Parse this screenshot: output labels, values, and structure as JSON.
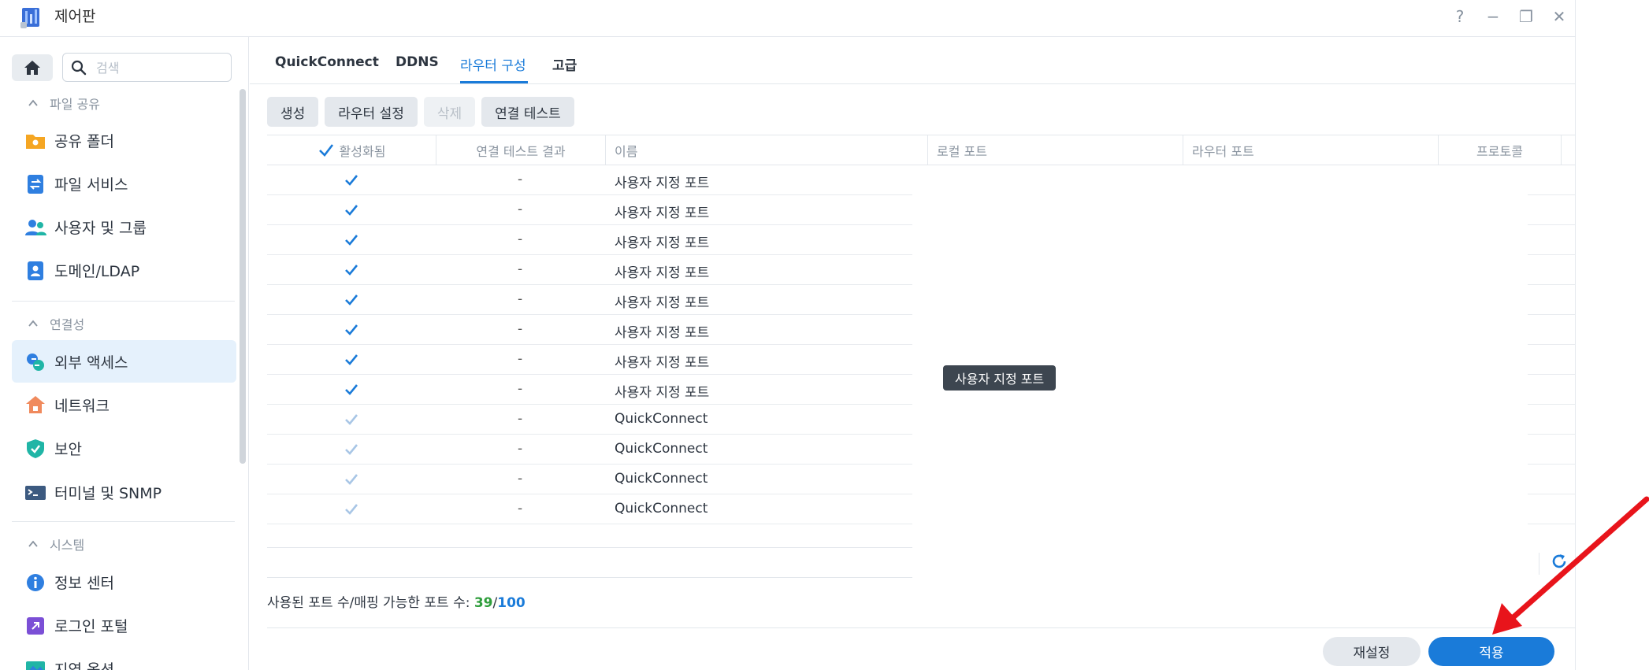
{
  "window": {
    "title": "제어판",
    "controls": [
      "?",
      "−",
      "❐",
      "✕"
    ]
  },
  "sidebar": {
    "search_placeholder": "검색",
    "sections": [
      {
        "label": "파일 공유",
        "items": [
          {
            "label": "공유 폴더",
            "icon": "shared-folder-icon"
          },
          {
            "label": "파일 서비스",
            "icon": "file-services-icon"
          },
          {
            "label": "사용자 및 그룹",
            "icon": "users-groups-icon"
          },
          {
            "label": "도메인/LDAP",
            "icon": "domain-ldap-icon"
          }
        ]
      },
      {
        "label": "연결성",
        "items": [
          {
            "label": "외부 액세스",
            "icon": "external-access-icon",
            "active": true
          },
          {
            "label": "네트워크",
            "icon": "network-icon"
          },
          {
            "label": "보안",
            "icon": "security-shield-icon"
          },
          {
            "label": "터미널 및 SNMP",
            "icon": "terminal-icon"
          }
        ]
      },
      {
        "label": "시스템",
        "items": [
          {
            "label": "정보 센터",
            "icon": "info-center-icon"
          },
          {
            "label": "로그인 포털",
            "icon": "login-portal-icon"
          },
          {
            "label": "지역 옵션",
            "icon": "regional-options-icon"
          }
        ]
      }
    ]
  },
  "tabs": [
    "QuickConnect",
    "DDNS",
    "라우터 구성",
    "고급"
  ],
  "active_tab": "라우터 구성",
  "toolbar": {
    "create": "생성",
    "router_settings": "라우터 설정",
    "delete": "삭제",
    "test_connection": "연결 테스트"
  },
  "table": {
    "columns": [
      "활성화됨",
      "연결 테스트 결과",
      "이름",
      "로컬 포트",
      "라우터 포트",
      "프로토콜"
    ],
    "rows": [
      {
        "enabled": true,
        "editable": true,
        "result": "-",
        "name": "사용자 지정 포트"
      },
      {
        "enabled": true,
        "editable": true,
        "result": "-",
        "name": "사용자 지정 포트"
      },
      {
        "enabled": true,
        "editable": true,
        "result": "-",
        "name": "사용자 지정 포트"
      },
      {
        "enabled": true,
        "editable": true,
        "result": "-",
        "name": "사용자 지정 포트"
      },
      {
        "enabled": true,
        "editable": true,
        "result": "-",
        "name": "사용자 지정 포트"
      },
      {
        "enabled": true,
        "editable": true,
        "result": "-",
        "name": "사용자 지정 포트"
      },
      {
        "enabled": true,
        "editable": true,
        "result": "-",
        "name": "사용자 지정 포트"
      },
      {
        "enabled": true,
        "editable": true,
        "result": "-",
        "name": "사용자 지정 포트"
      },
      {
        "enabled": true,
        "editable": false,
        "result": "-",
        "name": "QuickConnect"
      },
      {
        "enabled": true,
        "editable": false,
        "result": "-",
        "name": "QuickConnect"
      },
      {
        "enabled": true,
        "editable": false,
        "result": "-",
        "name": "QuickConnect"
      },
      {
        "enabled": true,
        "editable": false,
        "result": "-",
        "name": "QuickConnect"
      }
    ]
  },
  "tooltip": "사용자 지정 포트",
  "port_count": {
    "label": "사용된 포트 수/매핑 가능한 포트 수:",
    "used": "39",
    "separator": "/",
    "total": "100"
  },
  "footer": {
    "reset": "재설정",
    "apply": "적용"
  },
  "colors": {
    "accent": "#1a7bd9",
    "used_count": "#2f9e3c",
    "annotation_arrow": "#e8141b"
  }
}
